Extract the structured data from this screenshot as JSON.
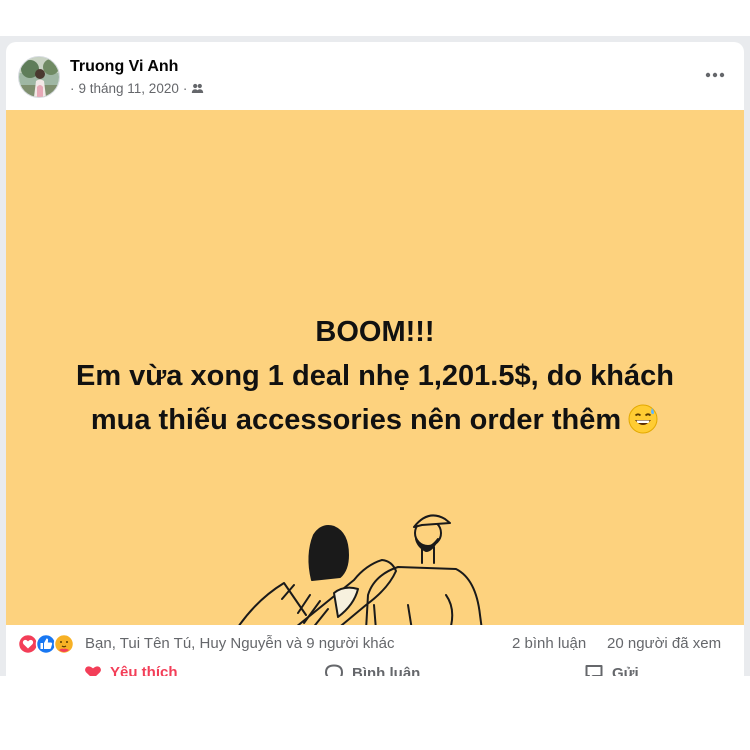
{
  "post": {
    "author": "Truong Vi Anh",
    "date": "9 tháng 11, 2020",
    "date_prefix": "·",
    "date_suffix": "·",
    "more_icon": "more-options-icon",
    "privacy_icon": "friends-privacy-icon",
    "image": {
      "background_color": "#fdd27e",
      "lines": [
        "BOOM!!!",
        "Em vừa xong 1 deal nhẹ 1,201.5$, do khách",
        "mua thiếu accessories nên order thêm"
      ],
      "emoji": "grinning-sweat-emoji"
    },
    "reactions": {
      "icons": [
        "love-reaction-icon",
        "like-reaction-icon",
        "care-reaction-icon"
      ],
      "text": "Bạn, Tui Tên Tú, Huy Nguyễn và 9 người khác",
      "comments": "2 bình luận",
      "views": "20 người đã xem"
    },
    "actions": {
      "like": "Yêu thích",
      "comment": "Bình luận",
      "share": "Gửi"
    }
  }
}
